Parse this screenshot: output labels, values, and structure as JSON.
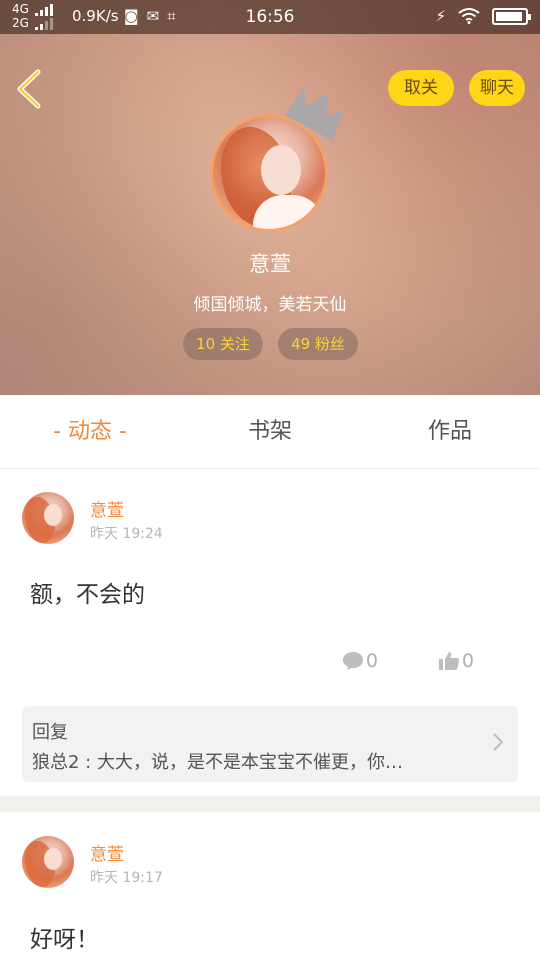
{
  "status_bar": {
    "net_top": "4G",
    "net_bottom": "2G",
    "speed": "0.9K/s",
    "time": "16:56",
    "battery_level": 0.92
  },
  "header": {
    "unfollow_label": "取关",
    "chat_label": "聊天",
    "name": "意萱",
    "motto": "倾国倾城，美若天仙",
    "following_label": "10 关注",
    "fans_label": "49 粉丝"
  },
  "tabs": [
    {
      "label": "- 动态 -",
      "active": true
    },
    {
      "label": "书架",
      "active": false
    },
    {
      "label": "作品",
      "active": false
    }
  ],
  "posts": [
    {
      "author": "意萱",
      "time": "昨天 19:24",
      "text": "额，不会的",
      "comments": "0",
      "likes": "0",
      "reply": {
        "title": "回复",
        "text": "狼总2 : 大大，说，是不是本宝宝不催更，你…"
      }
    },
    {
      "author": "意萱",
      "time": "昨天 19:17",
      "text": "好呀！"
    }
  ],
  "colors": {
    "accent_orange": "#f08a3c",
    "button_yellow": "#fcd617",
    "stat_text_yellow": "#fcd23a"
  }
}
